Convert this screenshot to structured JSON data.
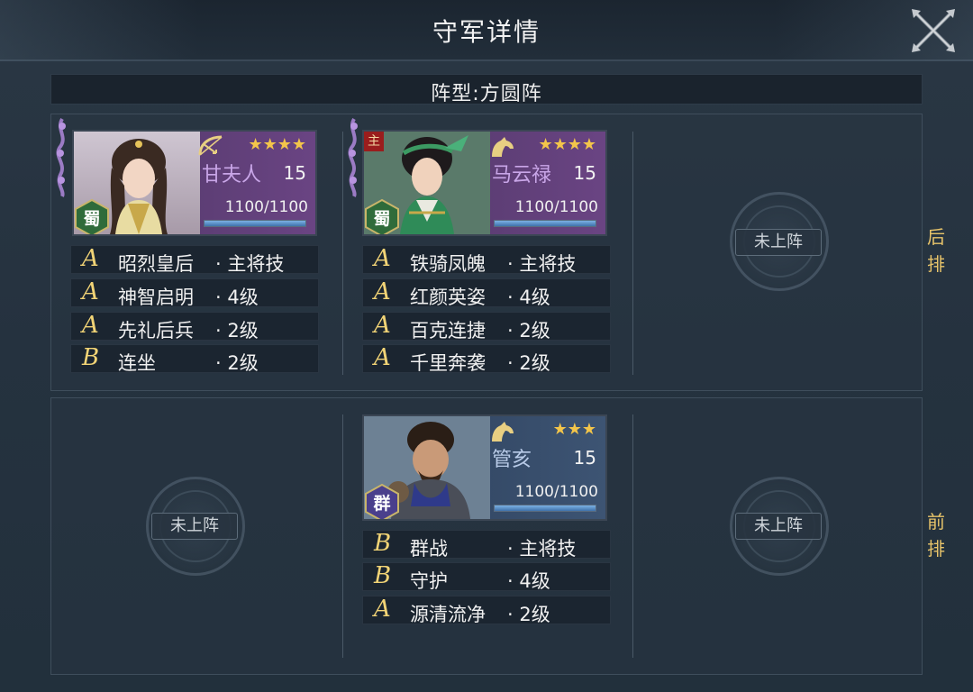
{
  "window": {
    "title": "守军详情"
  },
  "formation": {
    "label": "阵型:方圆阵"
  },
  "rows": {
    "back_label": "后排",
    "front_label": "前排"
  },
  "empty_slot_label": "未上阵",
  "generals": [
    {
      "name": "甘夫人",
      "stars": "★★★★",
      "level": "15",
      "hp": "1100/1100",
      "hp_fraction": 1.0,
      "faction": "蜀",
      "unit": "bow-icon",
      "lord_badge": "",
      "skills": [
        {
          "grade": "A",
          "name": "昭烈皇后",
          "level": "· 主将技"
        },
        {
          "grade": "A",
          "name": "神智启明",
          "level": "· 4级"
        },
        {
          "grade": "A",
          "name": "先礼后兵",
          "level": "· 2级"
        },
        {
          "grade": "B",
          "name": "连坐",
          "level": "· 2级"
        }
      ]
    },
    {
      "name": "马云禄",
      "stars": "★★★★",
      "level": "15",
      "hp": "1100/1100",
      "hp_fraction": 1.0,
      "faction": "蜀",
      "unit": "horse-icon",
      "lord_badge": "主",
      "skills": [
        {
          "grade": "A",
          "name": "铁骑凤魄",
          "level": "· 主将技"
        },
        {
          "grade": "A",
          "name": "红颜英姿",
          "level": "· 4级"
        },
        {
          "grade": "A",
          "name": "百克连捷",
          "level": "· 2级"
        },
        {
          "grade": "A",
          "name": "千里奔袭",
          "level": "· 2级"
        }
      ]
    },
    {
      "name": "管亥",
      "stars": "★★★",
      "level": "15",
      "hp": "1100/1100",
      "hp_fraction": 1.0,
      "faction": "群",
      "unit": "horse-icon",
      "lord_badge": "",
      "skills": [
        {
          "grade": "B",
          "name": "群战",
          "level": "· 主将技"
        },
        {
          "grade": "B",
          "name": "守护",
          "level": "· 4级"
        },
        {
          "grade": "A",
          "name": "源清流净",
          "level": "· 2级"
        }
      ]
    }
  ],
  "colors": {
    "star": "#f3c54a",
    "grade": "#f2d476",
    "row_label": "#e8c46a",
    "shu": "#2f6b3a",
    "qun": "#4a3f8c"
  }
}
